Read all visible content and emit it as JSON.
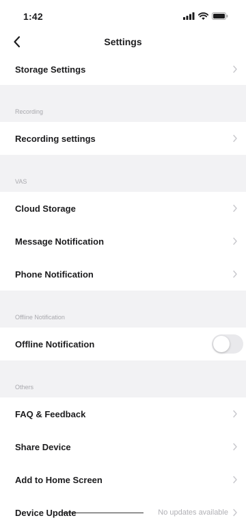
{
  "status_bar": {
    "time": "1:42",
    "icons": [
      "signal-icon",
      "wifi-icon",
      "battery-icon"
    ]
  },
  "nav": {
    "title": "Settings",
    "back_icon": "chevron-left-icon"
  },
  "rows": {
    "storage_settings": "Storage Settings",
    "recording_settings": "Recording settings",
    "cloud_storage": "Cloud Storage",
    "message_notification": "Message Notification",
    "phone_notification": "Phone Notification",
    "offline_notification": "Offline Notification",
    "faq_feedback": "FAQ & Feedback",
    "share_device": "Share Device",
    "add_to_home_screen": "Add to Home Screen",
    "device_update": "Device Update",
    "device_update_status": "No updates available"
  },
  "sections": {
    "recording": "Recording",
    "vas": "VAS",
    "offline_notification": "Offline Notification",
    "others": "Others"
  },
  "offline_toggle": {
    "enabled": false
  },
  "colors": {
    "background": "#f2f2f4",
    "row_background": "#ffffff",
    "section_text": "#a8a8ad",
    "chevron": "#c7c7cc",
    "toggle_off": "#e9e9ec"
  }
}
